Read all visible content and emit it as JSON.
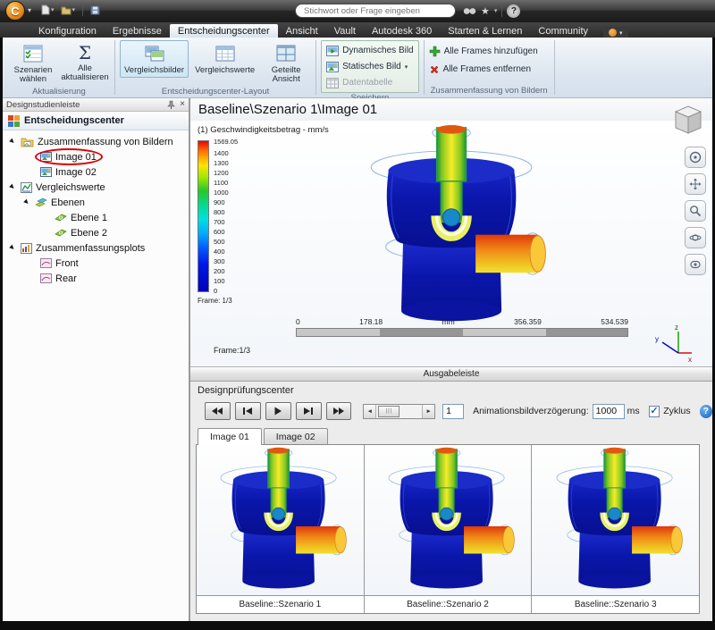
{
  "icons": {
    "caret_down": "▾",
    "close": "×",
    "star": "★",
    "expander_open": "▶",
    "sigma": "Σ",
    "grip": "|||",
    "check": "✓",
    "slider_left": "◄",
    "slider_right": "►"
  },
  "titlebar": {
    "logo_letter": "C",
    "search": {
      "placeholder": "Stichwort oder Frage eingeben"
    },
    "help_label": "?"
  },
  "menubar": {
    "tabs": [
      {
        "label": "Konfiguration"
      },
      {
        "label": "Ergebnisse"
      },
      {
        "label": "Entscheidungscenter"
      },
      {
        "label": "Ansicht"
      },
      {
        "label": "Vault"
      },
      {
        "label": "Autodesk 360"
      },
      {
        "label": "Starten & Lernen"
      },
      {
        "label": "Community"
      }
    ]
  },
  "ribbon": {
    "groups": {
      "aktualisierung": {
        "label": "Aktualisierung",
        "szenarien_btn": "Szenarien wählen",
        "alle_btn": "Alle aktualisieren"
      },
      "layout": {
        "label": "Entscheidungscenter-Layout",
        "vergleichsbilder": "Vergleichsbilder",
        "vergleichswerte": "Vergleichswerte",
        "geteilte_ansicht": "Geteilte Ansicht"
      },
      "speichern": {
        "label": "Speichern",
        "dynamisches_bild": "Dynamisches Bild",
        "statisches_bild": "Statisches Bild",
        "datentabelle": "Datentabelle"
      },
      "zusammenfassung": {
        "label": "Zusammenfassung von Bildern",
        "add_frames": "Alle Frames hinzufügen",
        "remove_frames": "Alle Frames entfernen"
      }
    }
  },
  "sidebar": {
    "title": "Designstudienleiste",
    "header": "Entscheidungscenter",
    "tree": [
      {
        "label": "Zusammenfassung von Bildern"
      },
      {
        "label": "Image 01"
      },
      {
        "label": "Image 02"
      },
      {
        "label": "Vergleichswerte"
      },
      {
        "label": "Ebenen"
      },
      {
        "label": "Ebene 1"
      },
      {
        "label": "Ebene 2"
      },
      {
        "label": "Zusammenfassungsplots"
      },
      {
        "label": "Front"
      },
      {
        "label": "Rear"
      }
    ]
  },
  "viewport": {
    "title": "Baseline\\Szenario 1\\Image 01",
    "legend": {
      "title": "(1) Geschwindigkeitsbetrag - mm/s",
      "max": "1569.05",
      "ticks": [
        "1400",
        "1300",
        "1200",
        "1100",
        "1000",
        "900",
        "800",
        "700",
        "600",
        "500",
        "400",
        "300",
        "200",
        "100",
        "0"
      ],
      "frame": "Frame: 1/3"
    },
    "ruler": {
      "t0": "0",
      "t1": "178.18",
      "unit": "mm",
      "t2": "356.359",
      "t3": "534.539"
    },
    "frame_label": "Frame:1/3",
    "axis": {
      "x": "x",
      "y": "y",
      "z": "z"
    }
  },
  "output_bar": {
    "label": "Ausgabeleiste"
  },
  "review": {
    "title": "Designprüfungscenter",
    "frame_value": "1",
    "delay_label": "Animationsbildverzögerung:",
    "delay_value": "1000",
    "delay_unit": "ms",
    "cycle_label": "Zyklus",
    "cycle_checked": true,
    "help_label": "?"
  },
  "image_tabs": [
    {
      "label": "Image 01"
    },
    {
      "label": "Image 02"
    }
  ],
  "thumbnails": [
    {
      "caption": "Baseline::Szenario 1"
    },
    {
      "caption": "Baseline::Szenario 2"
    },
    {
      "caption": "Baseline::Szenario 3"
    }
  ]
}
